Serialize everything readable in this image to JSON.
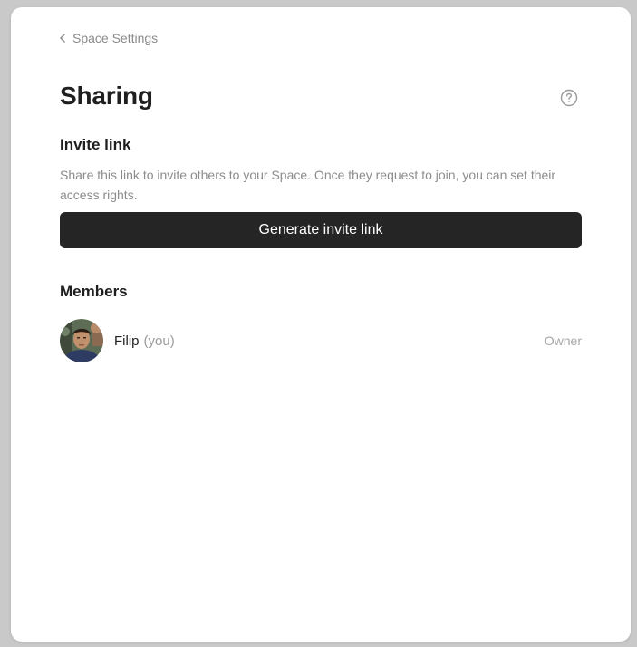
{
  "nav": {
    "back_label": "Space Settings",
    "back_icon": "chevron-left-icon"
  },
  "page": {
    "title": "Sharing",
    "help_icon": "question-circle-icon"
  },
  "invite": {
    "title": "Invite link",
    "description": "Share this link to invite others to your Space. Once they request to join, you can set their access rights.",
    "button_label": "Generate invite link"
  },
  "members": {
    "title": "Members",
    "items": [
      {
        "name": "Filip",
        "suffix": "(you)",
        "role": "Owner",
        "avatar_icon": "user-avatar-photo"
      }
    ]
  },
  "colors": {
    "button_bg": "#252525",
    "background": "#c9c9c9",
    "panel": "#ffffff"
  }
}
